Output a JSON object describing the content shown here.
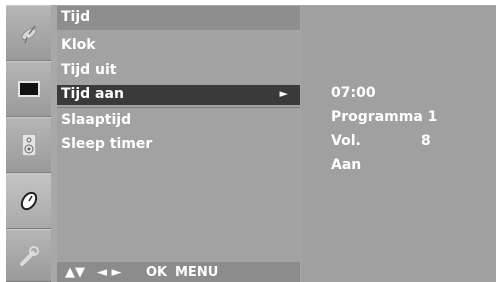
{
  "sidebar": {
    "icons": [
      {
        "name": "satellite-dish-icon"
      },
      {
        "name": "picture-icon"
      },
      {
        "name": "speaker-icon"
      },
      {
        "name": "clock-icon"
      },
      {
        "name": "wrench-icon"
      }
    ]
  },
  "menu": {
    "title": "Tijd",
    "items": [
      {
        "label": "Klok"
      },
      {
        "label": "Tijd uit"
      },
      {
        "label": "Tijd aan",
        "arrow": "►"
      },
      {
        "label": "Slaaptijd"
      },
      {
        "label": "Sleep timer"
      }
    ],
    "nav_hint": {
      "updown": "▲▼",
      "leftright": "◄ ►",
      "ok": "OK",
      "menu": "MENU"
    }
  },
  "values": {
    "time": "07:00",
    "program": "Programma 1",
    "vol_label": "Vol.",
    "vol_value": "8",
    "state": "Aan"
  }
}
